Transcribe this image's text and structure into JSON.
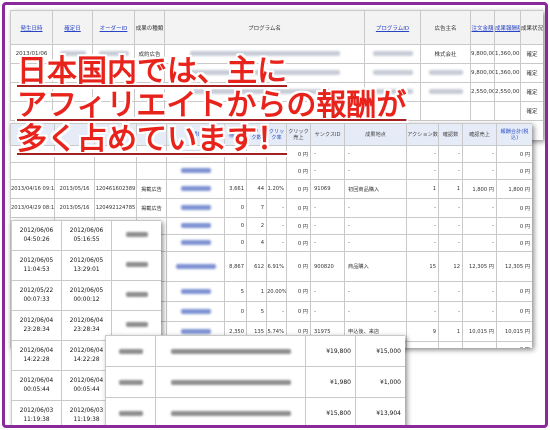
{
  "headline": {
    "lines": [
      "日本国内では、主に",
      "アフィリエイトからの報酬が",
      "多く占めています！"
    ]
  },
  "report_top": {
    "headers": [
      "発生日時",
      "確定日",
      "オーダーID",
      "成果の種類",
      "プログラム名",
      "プログラムID",
      "広告主名",
      "注文金額",
      "成果報酬額",
      "成果状況"
    ],
    "rows": [
      {
        "date": "2013/01/06",
        "type": "成約広告",
        "advertiser": "株式会社",
        "amount": "9,800,00",
        "reward": "1,360,00",
        "status": "確定"
      },
      {
        "date": "",
        "type": "",
        "advertiser": "",
        "amount": "9,800,00",
        "reward": "1,360,00",
        "status": "確定"
      },
      {
        "date": "",
        "type": "",
        "advertiser": "",
        "amount": "2,550,00",
        "reward": "2,550,00",
        "status": "確定"
      },
      {
        "date": "",
        "type": "",
        "advertiser": "",
        "amount": "",
        "reward": "",
        "status": "確定"
      }
    ]
  },
  "report_mid": {
    "headers": [
      "成果ID",
      "クリック数",
      "クリック率",
      "クリック売上",
      "サンクスID",
      "成果地点",
      "アクション数",
      "確認数",
      "確認売上",
      "報酬合計(税込)"
    ],
    "rows": [
      {
        "date": "",
        "confirm": "",
        "orderid": "",
        "type": "",
        "imp": "",
        "clicks": "",
        "ctr": "",
        "csales": "0 円",
        "tid": "-",
        "point": "-",
        "actions": "-",
        "conf": "-",
        "csales2": "-",
        "total": "0 円"
      },
      {
        "date": "",
        "confirm": "",
        "orderid": "",
        "type": "",
        "imp": "",
        "clicks": "",
        "ctr": "",
        "csales": "0 円",
        "tid": "-",
        "point": "-",
        "actions": "-",
        "conf": "-",
        "csales2": "-",
        "total": "0 円"
      },
      {
        "date": "2013/04/16 09:10:40",
        "confirm": "2013/05/16",
        "orderid": "120461602389",
        "type": "掲載広告",
        "imp": "3,661",
        "clicks": "44",
        "ctr": "1.20%",
        "csales": "0 円",
        "tid": "91069",
        "point": "初回商品購入",
        "actions": "1",
        "conf": "1",
        "csales2": "1,800 円",
        "total": "1,800 円"
      },
      {
        "date": "2013/04/29 08:10:13",
        "confirm": "2013/05/16",
        "orderid": "120492124785",
        "type": "掲載広告",
        "imp": "0",
        "clicks": "7",
        "ctr": "-",
        "csales": "0 円",
        "tid": "-",
        "point": "-",
        "actions": "-",
        "conf": "-",
        "csales2": "-",
        "total": "0 円"
      },
      {
        "date": "",
        "confirm": "",
        "orderid": "",
        "type": "",
        "imp": "0",
        "clicks": "2",
        "ctr": "-",
        "csales": "0 円",
        "tid": "-",
        "point": "-",
        "actions": "-",
        "conf": "-",
        "csales2": "-",
        "total": "0 円"
      },
      {
        "date": "",
        "confirm": "",
        "orderid": "",
        "type": "",
        "imp": "0",
        "clicks": "4",
        "ctr": "-",
        "csales": "0 円",
        "tid": "-",
        "point": "-",
        "actions": "-",
        "conf": "-",
        "csales2": "-",
        "total": "0 円"
      },
      {
        "date": "",
        "confirm": "",
        "orderid": "",
        "type": "",
        "imp": "8,867",
        "clicks": "612",
        "ctr": "6.91%",
        "csales": "0 円",
        "tid": "900820",
        "point": "商品購入",
        "actions": "15",
        "conf": "12",
        "csales2": "12,305 円",
        "total": "12,305 円"
      },
      {
        "date": "",
        "confirm": "",
        "orderid": "",
        "type": "",
        "imp": "5",
        "clicks": "1",
        "ctr": "20.00%",
        "csales": "0 円",
        "tid": "-",
        "point": "-",
        "actions": "-",
        "conf": "-",
        "csales2": "-",
        "total": "0 円"
      },
      {
        "date": "",
        "confirm": "",
        "orderid": "",
        "type": "",
        "imp": "0",
        "clicks": "5",
        "ctr": "-",
        "csales": "0 円",
        "tid": "-",
        "point": "-",
        "actions": "-",
        "conf": "-",
        "csales2": "-",
        "total": "0 円"
      },
      {
        "date": "",
        "confirm": "",
        "orderid": "",
        "type": "",
        "imp": "2,350",
        "clicks": "135",
        "ctr": "5.74%",
        "csales": "0 円",
        "tid": "31975",
        "point": "申込後、来店",
        "actions": "9",
        "conf": "1",
        "csales2": "10,015 円",
        "total": "10,015 円"
      },
      {
        "date": "",
        "confirm": "",
        "orderid": "",
        "type": "",
        "imp": "",
        "clicks": "",
        "ctr": "",
        "csales": "",
        "tid": "",
        "point": "",
        "actions": "",
        "conf": "",
        "csales2": "",
        "total": "0 円"
      }
    ]
  },
  "report_dates": {
    "rows": [
      {
        "a": "2012/06/06",
        "b": "04:50:26",
        "c": "2012/06/06",
        "d": "05:16:55"
      },
      {
        "a": "2012/06/05",
        "b": "11:04:53",
        "c": "2012/06/05",
        "d": "13:29:01"
      },
      {
        "a": "2012/05/22",
        "b": "00:07:33",
        "c": "2012/06/05",
        "d": "00:00:12"
      },
      {
        "a": "2012/06/04",
        "b": "23:28:34",
        "c": "2012/06/04",
        "d": "23:28:34"
      },
      {
        "a": "2012/06/04",
        "b": "14:22:28",
        "c": "2012/06/04",
        "d": "14:22:28"
      },
      {
        "a": "2012/06/04",
        "b": "00:05:44",
        "c": "2012/06/04",
        "d": "00:05:44"
      },
      {
        "a": "2012/06/03",
        "b": "11:19:38",
        "c": "2012/06/03",
        "d": "11:19:38"
      }
    ]
  },
  "report_amounts": {
    "rows": [
      {
        "price": "¥19,800",
        "reward": "¥15,000"
      },
      {
        "price": "¥1,980",
        "reward": "¥1,000"
      },
      {
        "price": "¥15,800",
        "reward": "¥13,904"
      }
    ]
  }
}
